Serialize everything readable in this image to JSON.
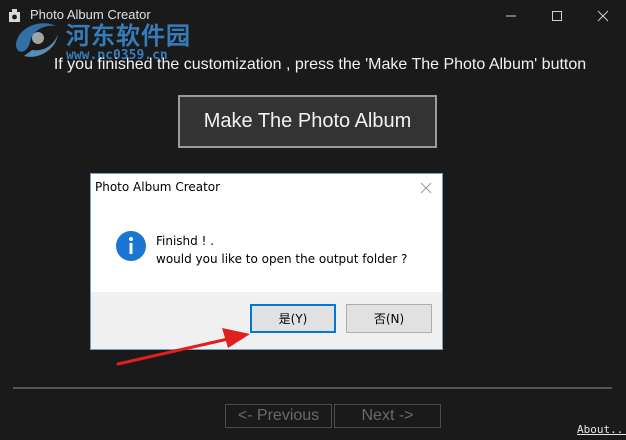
{
  "window": {
    "title": "Photo Album Creator",
    "icon": "camera-icon"
  },
  "watermark": {
    "site_cn": "河东软件园",
    "url": "www.pc0359.cn"
  },
  "main": {
    "instruction": "If you finished the customization , press the 'Make The Photo Album' button",
    "make_button_label": "Make The Photo Album"
  },
  "navigation": {
    "previous_label": "<- Previous",
    "next_label": "Next ->",
    "about_label": "About..."
  },
  "dialog": {
    "title": "Photo Album Creator",
    "icon": "info-icon",
    "message_line1": "Finishd ! .",
    "message_line2": "would you like to open the output folder ?",
    "yes_label": "是(Y)",
    "no_label": "否(N)"
  },
  "colors": {
    "window_bg": "#1a1a1a",
    "dialog_accent": "#0078d7",
    "arrow": "#e02020",
    "watermark": "#3a8ed6"
  }
}
